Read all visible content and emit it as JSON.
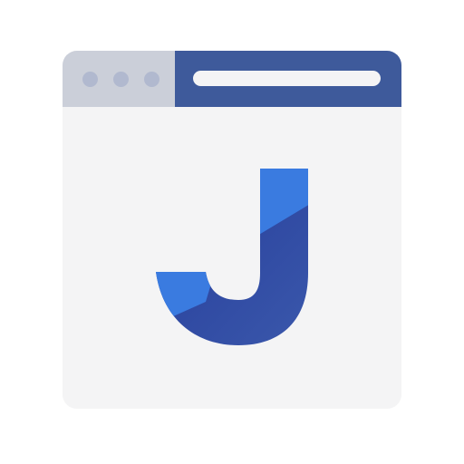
{
  "window": {
    "controls": [
      "window-dot",
      "window-dot",
      "window-dot"
    ],
    "address_bar": {
      "value": ""
    }
  },
  "logo": {
    "letter": "J",
    "icon": "letter-j-logo",
    "colors": {
      "light_blue": "#3a7be0",
      "mid_blue": "#2e4aa8",
      "dark_blue": "#23378f"
    }
  },
  "colors": {
    "frame_bg": "#f4f4f5",
    "controls_bg": "#cbcfd9",
    "dot": "#b1b9cf",
    "title_bar": "#3e5a9b"
  }
}
